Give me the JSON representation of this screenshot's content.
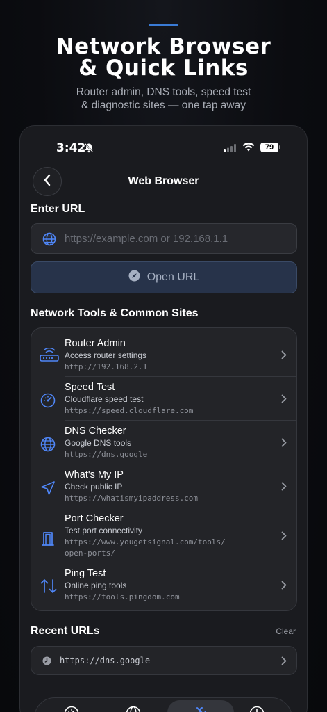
{
  "hero": {
    "title_line1": "Network Browser",
    "title_line2": "& Quick Links",
    "subtitle_line1": "Router admin, DNS tools, speed test",
    "subtitle_line2": "& diagnostic sites — one tap away"
  },
  "status_bar": {
    "time": "3:42",
    "battery": "79"
  },
  "nav": {
    "title": "Web Browser"
  },
  "url_section": {
    "label": "Enter URL",
    "placeholder": "https://example.com or 192.168.1.1",
    "value": "",
    "button_label": "Open URL"
  },
  "tools_section": {
    "label": "Network Tools & Common Sites",
    "items": [
      {
        "name": "Router Admin",
        "description": "Access router settings",
        "url": "http://192.168.2.1",
        "icon": "router-icon"
      },
      {
        "name": "Speed Test",
        "description": "Cloudflare speed test",
        "url": "https://speed.cloudflare.com",
        "icon": "speedometer-icon"
      },
      {
        "name": "DNS Checker",
        "description": "Google DNS tools",
        "url": "https://dns.google",
        "icon": "globe-icon"
      },
      {
        "name": "What's My IP",
        "description": "Check public IP",
        "url": "https://whatismyipaddress.com",
        "icon": "location-arrow-icon"
      },
      {
        "name": "Port Checker",
        "description": "Test port connectivity",
        "url_line1": "https://www.yougetsignal.com/tools/",
        "url_line2": "open-ports/",
        "icon": "door-icon"
      },
      {
        "name": "Ping Test",
        "description": "Online ping tools",
        "url": "https://tools.pingdom.com",
        "icon": "arrows-up-down-icon"
      }
    ]
  },
  "recent_section": {
    "label": "Recent URLs",
    "clear_label": "Clear",
    "items": [
      {
        "url": "https://dns.google",
        "icon": "clock-icon"
      }
    ]
  },
  "colors": {
    "accent": "#4f86f7",
    "background": "#0b0c10",
    "card": "#232428"
  }
}
